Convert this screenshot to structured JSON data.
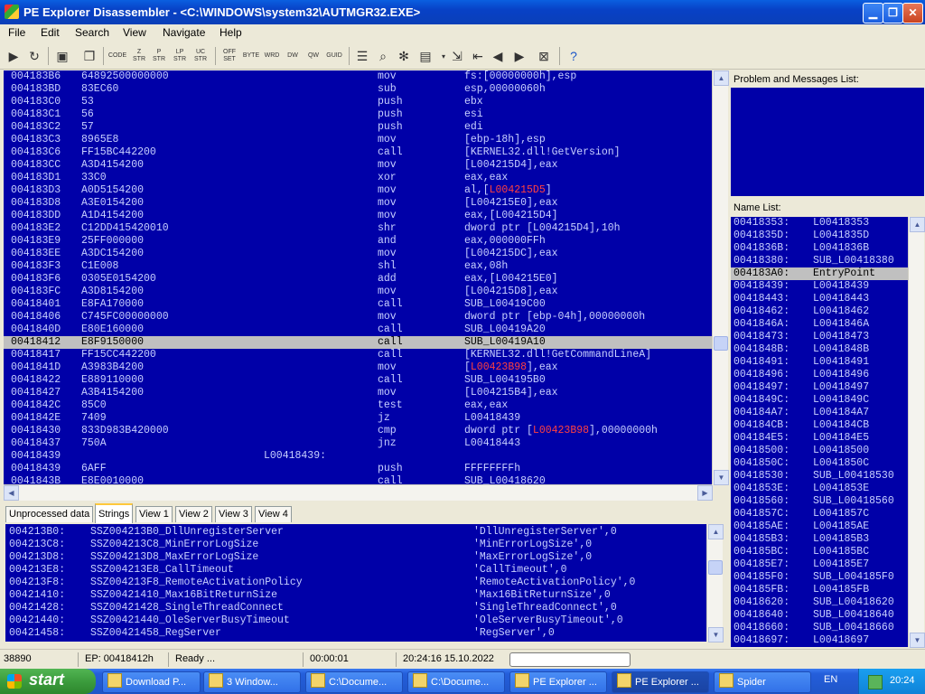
{
  "window": {
    "title": "PE Explorer Disassembler - <C:\\WINDOWS\\system32\\AUTMGR32.EXE>"
  },
  "menu": [
    "File",
    "Edit",
    "Search",
    "View",
    "Navigate",
    "Help"
  ],
  "toolbar": {
    "code_label": "CODE",
    "zstr_label": "Z STR",
    "pstr_label": "P STR",
    "lpstr_label": "LP STR",
    "ucstr_label": "UC STR",
    "offset_label": "OFF SET",
    "byte_label": "BYTE",
    "word_label": "WRD",
    "dword_label": "DW",
    "qword_label": "QW",
    "guid_label": "GUID"
  },
  "disasm": {
    "rows": [
      {
        "addr": "004183B6",
        "bytes": "64892500000000",
        "mn": "mov",
        "op": "fs:[00000000h],esp"
      },
      {
        "addr": "004183BD",
        "bytes": "83EC60",
        "mn": "sub",
        "op": "esp,00000060h"
      },
      {
        "addr": "004183C0",
        "bytes": "53",
        "mn": "push",
        "op": "ebx"
      },
      {
        "addr": "004183C1",
        "bytes": "56",
        "mn": "push",
        "op": "esi"
      },
      {
        "addr": "004183C2",
        "bytes": "57",
        "mn": "push",
        "op": "edi"
      },
      {
        "addr": "004183C3",
        "bytes": "8965E8",
        "mn": "mov",
        "op": "[ebp-18h],esp"
      },
      {
        "addr": "004183C6",
        "bytes": "FF15BC442200",
        "mn": "call",
        "op": "[KERNEL32.dll!GetVersion]"
      },
      {
        "addr": "004183CC",
        "bytes": "A3D4154200",
        "mn": "mov",
        "op": "[L004215D4],eax"
      },
      {
        "addr": "004183D1",
        "bytes": "33C0",
        "mn": "xor",
        "op": "eax,eax"
      },
      {
        "addr": "004183D3",
        "bytes": "A0D5154200",
        "mn": "mov",
        "op": "al,[",
        "red": "L004215D5",
        "post": "]"
      },
      {
        "addr": "004183D8",
        "bytes": "A3E0154200",
        "mn": "mov",
        "op": "[L004215E0],eax"
      },
      {
        "addr": "004183DD",
        "bytes": "A1D4154200",
        "mn": "mov",
        "op": "eax,[L004215D4]"
      },
      {
        "addr": "004183E2",
        "bytes": "C12DD415420010",
        "mn": "shr",
        "op": "dword ptr [L004215D4],10h"
      },
      {
        "addr": "004183E9",
        "bytes": "25FF000000",
        "mn": "and",
        "op": "eax,000000FFh"
      },
      {
        "addr": "004183EE",
        "bytes": "A3DC154200",
        "mn": "mov",
        "op": "[L004215DC],eax"
      },
      {
        "addr": "004183F3",
        "bytes": "C1E008",
        "mn": "shl",
        "op": "eax,08h"
      },
      {
        "addr": "004183F6",
        "bytes": "0305E0154200",
        "mn": "add",
        "op": "eax,[L004215E0]"
      },
      {
        "addr": "004183FC",
        "bytes": "A3D8154200",
        "mn": "mov",
        "op": "[L004215D8],eax"
      },
      {
        "addr": "00418401",
        "bytes": "E8FA170000",
        "mn": "call",
        "op": "SUB_L00419C00"
      },
      {
        "addr": "00418406",
        "bytes": "C745FC00000000",
        "mn": "mov",
        "op": "dword ptr [ebp-04h],00000000h"
      },
      {
        "addr": "0041840D",
        "bytes": "E80E160000",
        "mn": "call",
        "op": "SUB_L00419A20"
      },
      {
        "addr": "00418412",
        "bytes": "E8F9150000",
        "mn": "call",
        "op": "SUB_L00419A10",
        "selected": true
      },
      {
        "addr": "00418417",
        "bytes": "FF15CC442200",
        "mn": "call",
        "op": "[KERNEL32.dll!GetCommandLineA]"
      },
      {
        "addr": "0041841D",
        "bytes": "A3983B4200",
        "mn": "mov",
        "op": "[",
        "red": "L00423B98",
        "post": "],eax"
      },
      {
        "addr": "00418422",
        "bytes": "E889110000",
        "mn": "call",
        "op": "SUB_L004195B0"
      },
      {
        "addr": "00418427",
        "bytes": "A3B4154200",
        "mn": "mov",
        "op": "[L004215B4],eax"
      },
      {
        "addr": "0041842C",
        "bytes": "85C0",
        "mn": "test",
        "op": "eax,eax"
      },
      {
        "addr": "0041842E",
        "bytes": "7409",
        "mn": "jz",
        "op": "L00418439"
      },
      {
        "addr": "00418430",
        "bytes": "833D983B420000",
        "mn": "cmp",
        "op": "dword ptr [",
        "red": "L00423B98",
        "post": "],00000000h"
      },
      {
        "addr": "00418437",
        "bytes": "750A",
        "mn": "jnz",
        "op": "L00418443"
      },
      {
        "addr": "00418439",
        "bytes": "",
        "label": "L00418439:",
        "mn": "",
        "op": ""
      },
      {
        "addr": "00418439",
        "bytes": "6AFF",
        "mn": "push",
        "op": "FFFFFFFFh"
      },
      {
        "addr": "0041843B",
        "bytes": "E8E0010000",
        "mn": "call",
        "op": "SUB_L00418620"
      }
    ]
  },
  "tabs": [
    "Unprocessed data",
    "Strings",
    "View 1",
    "View 2",
    "View 3",
    "View 4"
  ],
  "active_tab": "Strings",
  "strings": [
    {
      "addr": "004213B0:",
      "name": "SSZ004213B0_DllUnregisterServer",
      "val": "'DllUnregisterServer',0"
    },
    {
      "addr": "004213C8:",
      "name": "SSZ004213C8_MinErrorLogSize",
      "val": "'MinErrorLogSize',0"
    },
    {
      "addr": "004213D8:",
      "name": "SSZ004213D8_MaxErrorLogSize",
      "val": "'MaxErrorLogSize',0"
    },
    {
      "addr": "004213E8:",
      "name": "SSZ004213E8_CallTimeout",
      "val": "'CallTimeout',0"
    },
    {
      "addr": "004213F8:",
      "name": "SSZ004213F8_RemoteActivationPolicy",
      "val": "'RemoteActivationPolicy',0"
    },
    {
      "addr": "00421410:",
      "name": "SSZ00421410_Max16BitReturnSize",
      "val": "'Max16BitReturnSize',0"
    },
    {
      "addr": "00421428:",
      "name": "SSZ00421428_SingleThreadConnect",
      "val": "'SingleThreadConnect',0"
    },
    {
      "addr": "00421440:",
      "name": "SSZ00421440_OleServerBusyTimeout",
      "val": "'OleServerBusyTimeout',0"
    },
    {
      "addr": "00421458:",
      "name": "SSZ00421458_RegServer",
      "val": "'RegServer',0"
    }
  ],
  "problems": {
    "title": "Problem and Messages List:"
  },
  "names": {
    "title": "Name List:",
    "rows": [
      {
        "addr": "00418353:",
        "name": "L00418353"
      },
      {
        "addr": "0041835D:",
        "name": "L0041835D"
      },
      {
        "addr": "0041836B:",
        "name": "L0041836B"
      },
      {
        "addr": "00418380:",
        "name": "SUB_L00418380"
      },
      {
        "addr": "004183A0:",
        "name": "EntryPoint",
        "selected": true
      },
      {
        "addr": "00418439:",
        "name": "L00418439"
      },
      {
        "addr": "00418443:",
        "name": "L00418443"
      },
      {
        "addr": "00418462:",
        "name": "L00418462"
      },
      {
        "addr": "0041846A:",
        "name": "L0041846A"
      },
      {
        "addr": "00418473:",
        "name": "L00418473"
      },
      {
        "addr": "0041848B:",
        "name": "L0041848B"
      },
      {
        "addr": "00418491:",
        "name": "L00418491"
      },
      {
        "addr": "00418496:",
        "name": "L00418496"
      },
      {
        "addr": "00418497:",
        "name": "L00418497"
      },
      {
        "addr": "0041849C:",
        "name": "L0041849C"
      },
      {
        "addr": "004184A7:",
        "name": "L004184A7"
      },
      {
        "addr": "004184CB:",
        "name": "L004184CB"
      },
      {
        "addr": "004184E5:",
        "name": "L004184E5"
      },
      {
        "addr": "00418500:",
        "name": "L00418500"
      },
      {
        "addr": "0041850C:",
        "name": "L0041850C"
      },
      {
        "addr": "00418530:",
        "name": "SUB_L00418530"
      },
      {
        "addr": "0041853E:",
        "name": "L0041853E"
      },
      {
        "addr": "00418560:",
        "name": "SUB_L00418560"
      },
      {
        "addr": "0041857C:",
        "name": "L0041857C"
      },
      {
        "addr": "004185AE:",
        "name": "L004185AE"
      },
      {
        "addr": "004185B3:",
        "name": "L004185B3"
      },
      {
        "addr": "004185BC:",
        "name": "L004185BC"
      },
      {
        "addr": "004185E7:",
        "name": "L004185E7"
      },
      {
        "addr": "004185F0:",
        "name": "SUB_L004185F0"
      },
      {
        "addr": "004185FB:",
        "name": "L004185FB"
      },
      {
        "addr": "00418620:",
        "name": "SUB_L00418620"
      },
      {
        "addr": "00418640:",
        "name": "SUB_L00418640"
      },
      {
        "addr": "00418660:",
        "name": "SUB_L00418660"
      },
      {
        "addr": "00418697:",
        "name": "L00418697"
      }
    ]
  },
  "status": {
    "count": "38890",
    "ep": "EP: 00418412h",
    "state": "Ready ...",
    "elapsed": "00:00:01",
    "datetime": "20:24:16 15.10.2022"
  },
  "taskbar": {
    "start": "start",
    "tasks": [
      "Download P...",
      "3 Window...",
      "C:\\Docume...",
      "C:\\Docume...",
      "PE Explorer ...",
      "PE Explorer ...",
      "Spider"
    ],
    "lang": "EN",
    "clock": "20:24"
  },
  "colors": {
    "pane_bg": "#0000a8",
    "text": "#c8d0ff",
    "selection": "#c0c0c0",
    "label_red": "#ff4040"
  }
}
